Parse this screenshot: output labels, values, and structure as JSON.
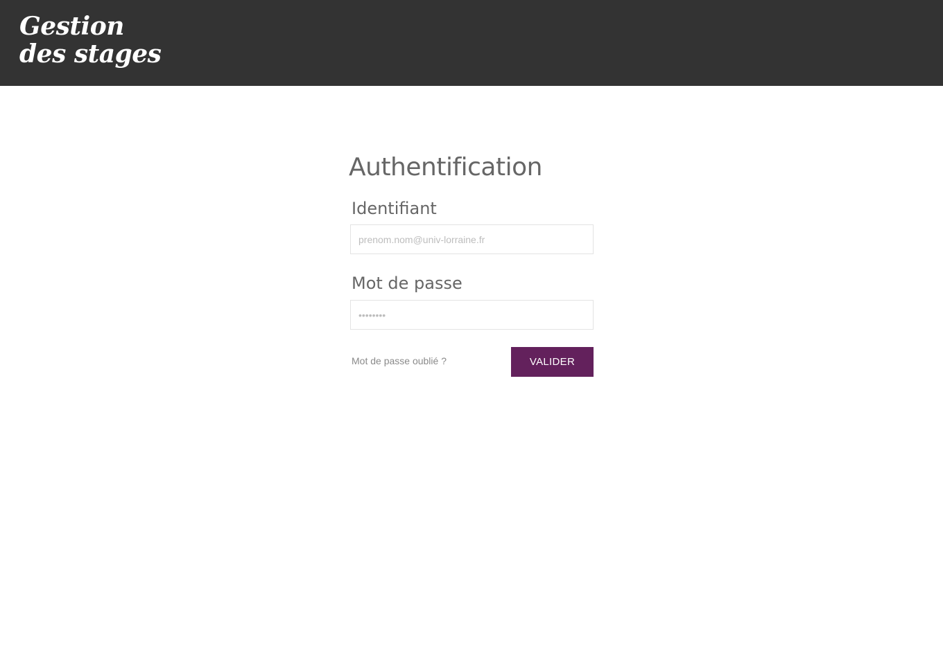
{
  "header": {
    "logo_line1": "Gestion",
    "logo_line2": "des stages",
    "background_color": "#333333"
  },
  "login": {
    "title": "Authentification",
    "username_label": "Identifiant",
    "username_placeholder": "prenom.nom@univ-lorraine.fr",
    "username_value": "",
    "password_label": "Mot de passe",
    "password_placeholder": "••••••••",
    "password_value": "",
    "forgot_link": "Mot de passe oublié ?",
    "submit_label": "VALIDER",
    "accent_color": "#63215c"
  }
}
